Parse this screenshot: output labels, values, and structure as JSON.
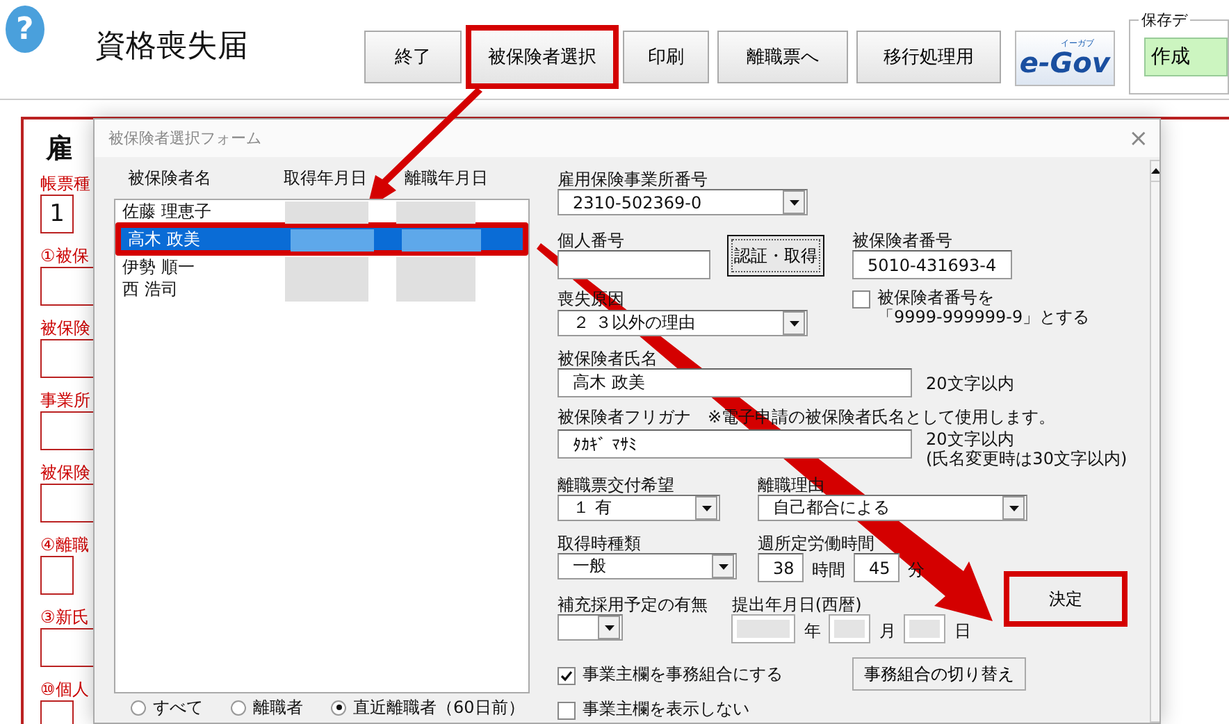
{
  "app": {
    "help": "?",
    "title": "資格喪失届"
  },
  "toolbar": [
    {
      "label": "終了",
      "annotated": false
    },
    {
      "label": "被保険者選択",
      "annotated": true
    },
    {
      "label": "印刷",
      "annotated": false
    },
    {
      "label": "離職票へ",
      "annotated": false
    },
    {
      "label": "移行処理用",
      "annotated": false
    }
  ],
  "egov_logo": {
    "text": "e-Gov",
    "ruby": "イーガブ"
  },
  "save_group": {
    "label": "保存デ",
    "button": "作成"
  },
  "background_form": {
    "title": "雇",
    "fields": [
      {
        "kind": "cells",
        "label": "帳票種",
        "cells": [
          "1"
        ]
      },
      {
        "kind": "field",
        "label": "①被保"
      },
      {
        "kind": "field",
        "label": "被保険"
      },
      {
        "kind": "field",
        "label": "事業所"
      },
      {
        "kind": "field",
        "label": "被保険"
      },
      {
        "kind": "split",
        "label": "④離職"
      },
      {
        "kind": "field",
        "label": "③新氏"
      },
      {
        "kind": "split",
        "label": "⑩個人"
      }
    ]
  },
  "dialog": {
    "title": "被保険者選択フォーム",
    "close": "×",
    "list": {
      "columns": [
        "被保険者名",
        "取得年月日",
        "離職年月日"
      ],
      "rows": [
        {
          "name": "佐藤 理恵子",
          "selected": false,
          "annotated": false
        },
        {
          "name": "高木 政美",
          "selected": true,
          "annotated": true
        },
        {
          "name": "伊勢 順一",
          "selected": false,
          "annotated": false
        },
        {
          "name": "西 浩司",
          "selected": false,
          "annotated": false
        }
      ]
    },
    "filters": [
      {
        "label": "すべて",
        "selected": false
      },
      {
        "label": "離職者",
        "selected": false
      },
      {
        "label": "直近離職者（60日前）",
        "selected": true
      }
    ],
    "office_number": {
      "label": "雇用保険事業所番号",
      "value": "2310-502369-0"
    },
    "personal_number": {
      "label": "個人番号",
      "button": "認証・取得"
    },
    "insured_number": {
      "label": "被保険者番号",
      "value": "5010-431693-4"
    },
    "dummy_number": {
      "lines": [
        "被保険者番号を",
        "「9999-999999-9」とする"
      ],
      "checked": false
    },
    "loss_reason": {
      "label": "喪失原因",
      "value": "２ ３以外の理由"
    },
    "name": {
      "label": "被保険者氏名",
      "value": "高木 政美",
      "note": "20文字以内"
    },
    "kana": {
      "label": "被保険者フリガナ",
      "remark": "※電子申請の被保険者氏名として使用します。",
      "value": "ﾀｶｷﾞ ﾏｻﾐ",
      "note": "20文字以内",
      "note2": "(氏名変更時は30文字以内)"
    },
    "separation_slip": {
      "label": "離職票交付希望",
      "value": "１ 有"
    },
    "separation_reason": {
      "label": "離職理由",
      "value": "自己都合による"
    },
    "acquisition_type": {
      "label": "取得時種類",
      "value": "一般"
    },
    "weekly_hours": {
      "label": "週所定労働時間",
      "hours": "38",
      "hours_unit": "時間",
      "minutes": "45",
      "minutes_unit": "分"
    },
    "replacement": {
      "label": "補充採用予定の有無"
    },
    "submit_date": {
      "label": "提出年月日(西暦)",
      "year_unit": "年",
      "month_unit": "月",
      "day_unit": "日"
    },
    "confirm": {
      "label": "決定",
      "annotated": true
    },
    "options": [
      {
        "label": "事業主欄を事務組合にする",
        "checked": true
      },
      {
        "label": "事業主欄を表示しない",
        "checked": false
      }
    ],
    "switch_button": "事務組合の切り替え"
  }
}
